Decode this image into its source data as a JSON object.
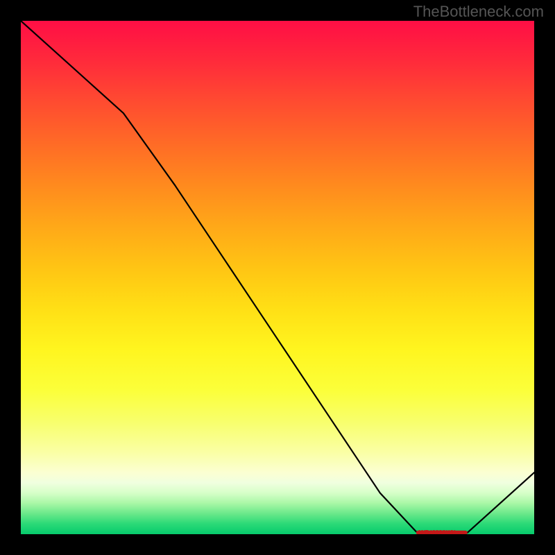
{
  "watermark": "TheBottleneck.com",
  "chart_data": {
    "type": "line",
    "title": "",
    "xlabel": "",
    "ylabel": "",
    "x": [
      0.0,
      0.1,
      0.2,
      0.3,
      0.4,
      0.5,
      0.6,
      0.7,
      0.77,
      0.82,
      0.87,
      1.0
    ],
    "y": [
      1.0,
      0.91,
      0.82,
      0.68,
      0.53,
      0.38,
      0.23,
      0.08,
      0.005,
      0.003,
      0.003,
      0.12
    ],
    "xlim": [
      0,
      1
    ],
    "ylim": [
      0,
      1
    ],
    "marker_range": [
      0.77,
      0.87
    ],
    "marker_y": 0.003,
    "gradient": "red-yellow-green vertical",
    "grid": false
  },
  "marker_label": "AMD XXXXX XX"
}
